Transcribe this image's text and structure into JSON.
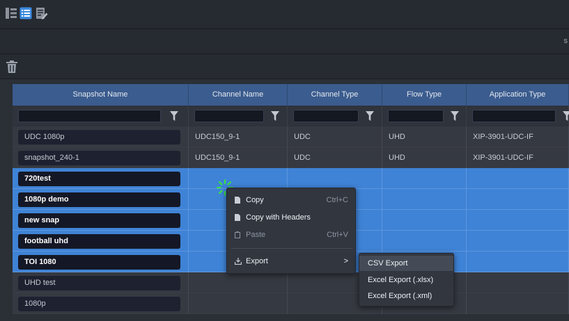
{
  "toolbar": {
    "icons": [
      "list-detail-icon",
      "list-view-icon",
      "edit-list-icon"
    ],
    "delete_icon": "trash-icon",
    "right_edge_text": "s"
  },
  "grid": {
    "columns": [
      "Snapshot Name",
      "Channel Name",
      "Channel Type",
      "Flow Type",
      "Application Type"
    ],
    "rows": [
      {
        "name": "UDC 1080p",
        "channel": "UDC150_9-1",
        "channel_type": "UDC",
        "flow": "UHD",
        "app": "XIP-3901-UDC-IF",
        "selected": false
      },
      {
        "name": "snapshot_240-1",
        "channel": "UDC150_9-1",
        "channel_type": "UDC",
        "flow": "UHD",
        "app": "XIP-3901-UDC-IF",
        "selected": false
      },
      {
        "name": "720test",
        "channel": "",
        "channel_type": "",
        "flow": "",
        "app": "",
        "selected": true
      },
      {
        "name": "1080p demo",
        "channel": "",
        "channel_type": "",
        "flow": "",
        "app": "",
        "selected": true
      },
      {
        "name": "new snap",
        "channel": "",
        "channel_type": "",
        "flow": "",
        "app": "",
        "selected": true
      },
      {
        "name": "football uhd",
        "channel": "",
        "channel_type": "",
        "flow": "",
        "app": "",
        "selected": true
      },
      {
        "name": "TOI 1080",
        "channel": "",
        "channel_type": "",
        "flow": "",
        "app": "",
        "selected": true
      },
      {
        "name": "UHD test",
        "channel": "",
        "channel_type": "",
        "flow": "",
        "app": "",
        "selected": false
      },
      {
        "name": "1080p",
        "channel": "",
        "channel_type": "",
        "flow": "",
        "app": "",
        "selected": false
      }
    ]
  },
  "context_menu": {
    "copy": "Copy",
    "copy_shortcut": "Ctrl+C",
    "copy_headers": "Copy with Headers",
    "paste": "Paste",
    "paste_shortcut": "Ctrl+V",
    "export": "Export",
    "export_arrow": ">"
  },
  "export_submenu": {
    "csv": "CSV Export",
    "xlsx": "Excel Export (.xlsx)",
    "xml": "Excel Export (.xml)"
  },
  "colors": {
    "header": "#3b5c8e",
    "selected_row": "#3f83d6",
    "accent_icon": "#3d8be0",
    "cursor": "#39e639"
  }
}
